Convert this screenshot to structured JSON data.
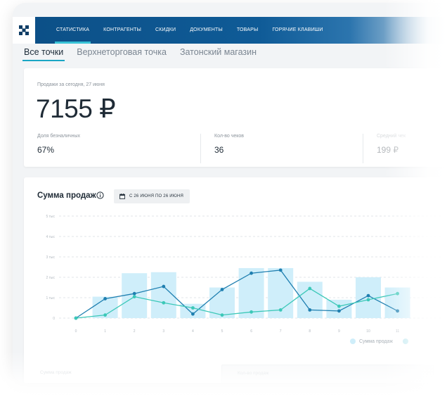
{
  "nav": {
    "items": [
      {
        "label": "СТАТИСТИКА",
        "active": true
      },
      {
        "label": "КОНТРАГЕНТЫ"
      },
      {
        "label": "СКИДКИ"
      },
      {
        "label": "ДОКУМЕНТЫ"
      },
      {
        "label": "ТОВАРЫ"
      },
      {
        "label": "ГОРЯЧИЕ КЛАВИШИ"
      }
    ]
  },
  "tabs": [
    {
      "label": "Все точки",
      "active": true
    },
    {
      "label": "Верхнеторговая точка"
    },
    {
      "label": "Затонский магазин"
    }
  ],
  "summary": {
    "sales_label": "Продажи за сегодня, 27 июня",
    "sales_amount": "7155 ₽",
    "stats": [
      {
        "label": "Доля безналичных",
        "value": "67%"
      },
      {
        "label": "Кол-во чеков",
        "value": "36"
      },
      {
        "label": "Средний чек",
        "value": "199 ₽"
      }
    ]
  },
  "sales_chart": {
    "title": "Сумма продаж",
    "date_range": "С 26 ИЮНЯ ПО 26 ИЮНЯ",
    "legend": {
      "series1": "Сумма продаж"
    }
  },
  "bottom": {
    "left_label": "Сумма продаж",
    "right_label": "Кол-во продаж"
  },
  "colors": {
    "nav_bg": "#0f5b97",
    "accent": "#1aa6c4",
    "bar": "#cfeefa",
    "line_dark": "#1f7fb0",
    "line_light": "#3cc8b8"
  },
  "chart_data": {
    "type": "bar",
    "title": "Сумма продаж",
    "y_ticks": [
      "5 тыс",
      "4 тыс",
      "3 тыс",
      "2 тыс",
      "1 тыс",
      "0"
    ],
    "x_ticks": [
      "0",
      "1",
      "2",
      "3",
      "4",
      "5",
      "6",
      "7",
      "8",
      "9",
      "10",
      "11"
    ],
    "ylim": [
      0,
      5000
    ],
    "categories": [
      0,
      1,
      2,
      3,
      4,
      5,
      6,
      7,
      8,
      9,
      10,
      11
    ],
    "series": [
      {
        "name": "Сумма продаж",
        "kind": "bar",
        "color": "#cfeefa",
        "values": [
          null,
          1050,
          2200,
          2250,
          700,
          1500,
          2450,
          2450,
          1780,
          900,
          2000,
          1500
        ]
      },
      {
        "kind": "line",
        "color": "#1f7fb0",
        "values": [
          0,
          950,
          1200,
          1550,
          200,
          1400,
          2200,
          2350,
          400,
          350,
          1100,
          350
        ]
      },
      {
        "kind": "line",
        "color": "#3cc8b8",
        "values": [
          0,
          150,
          1050,
          750,
          500,
          150,
          300,
          400,
          1450,
          580,
          900,
          1200
        ]
      }
    ]
  }
}
